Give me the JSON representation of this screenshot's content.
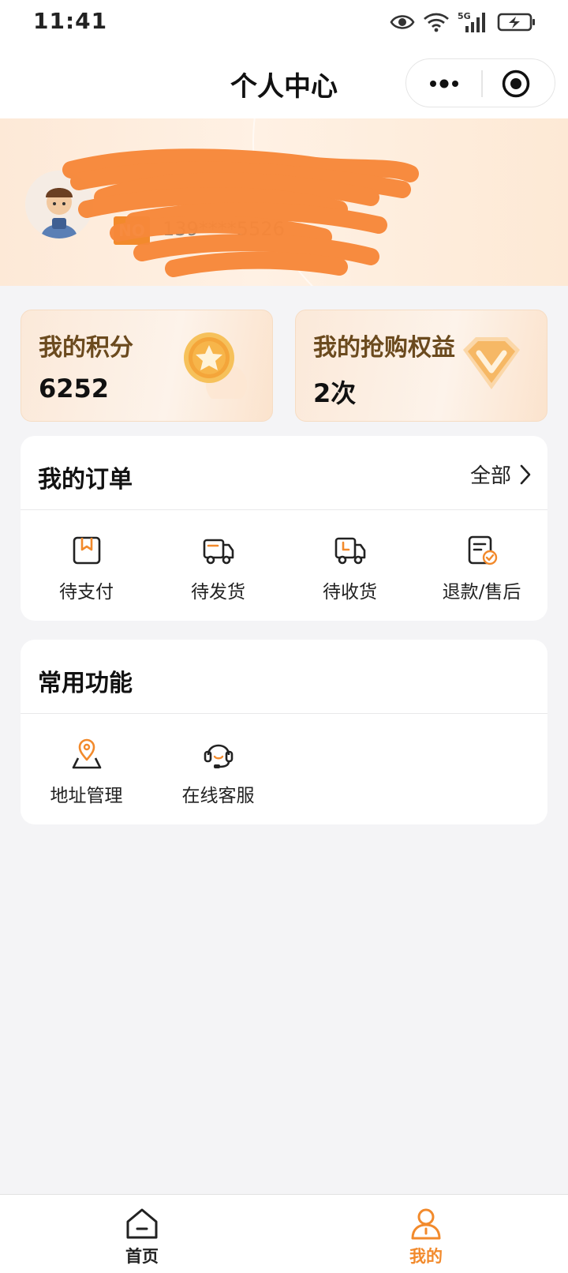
{
  "status_bar": {
    "time": "11:41",
    "network": "5G"
  },
  "nav": {
    "title": "个人中心"
  },
  "profile": {
    "member_tag": "NO",
    "phone": "139****5526"
  },
  "stats": [
    {
      "title": "我的积分",
      "value": "6252",
      "icon": "star-coin-icon"
    },
    {
      "title": "我的抢购权益",
      "value": "2次",
      "icon": "diamond-v-icon"
    }
  ],
  "orders": {
    "title": "我的订单",
    "more_label": "全部",
    "items": [
      {
        "label": "待支付",
        "icon": "wallet-icon"
      },
      {
        "label": "待发货",
        "icon": "truck-icon"
      },
      {
        "label": "待收货",
        "icon": "truck-clock-icon"
      },
      {
        "label": "退款/售后",
        "icon": "refund-doc-icon"
      }
    ]
  },
  "functions": {
    "title": "常用功能",
    "items": [
      {
        "label": "地址管理",
        "icon": "location-map-icon"
      },
      {
        "label": "在线客服",
        "icon": "headset-icon"
      }
    ]
  },
  "tab_bar": {
    "items": [
      {
        "label": "首页",
        "icon": "home-icon",
        "active": false
      },
      {
        "label": "我的",
        "icon": "user-icon",
        "active": true
      }
    ]
  },
  "colors": {
    "accent": "#f28a2c",
    "brown": "#6b4a1e",
    "background": "#f4f4f6"
  }
}
